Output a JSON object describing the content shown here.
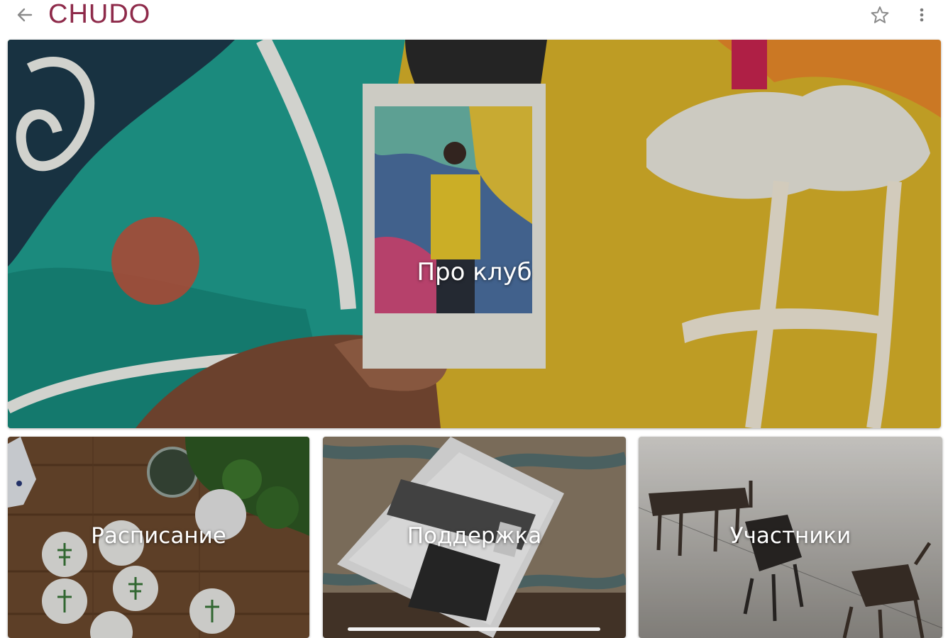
{
  "app_bar": {
    "title": "CHUDO",
    "back_icon": "arrow-left-icon",
    "favorite_icon": "star-outline-icon",
    "menu_icon": "more-vertical-icon",
    "title_color": "#8e2a4a"
  },
  "tiles": {
    "hero": {
      "label": "Про клуб"
    },
    "schedule": {
      "label": "Расписание"
    },
    "support": {
      "label": "Поддержка"
    },
    "members": {
      "label": "Участники"
    }
  }
}
